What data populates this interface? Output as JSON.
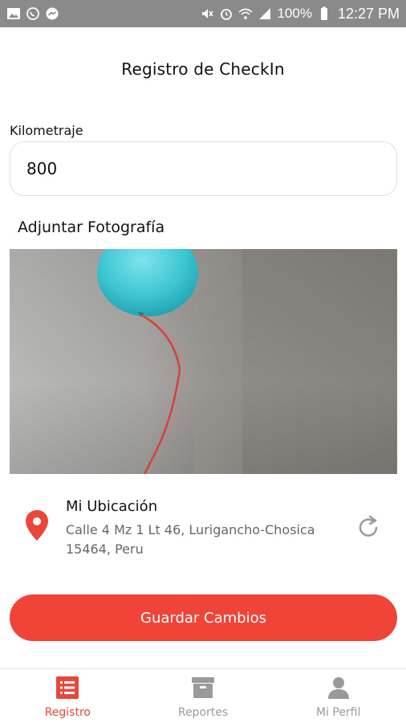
{
  "status_bar": {
    "battery": "100%",
    "time": "12:27 PM"
  },
  "screen": {
    "title": "Registro de CheckIn"
  },
  "form": {
    "kilometraje_label": "Kilometraje",
    "kilometraje_value": "800",
    "photo_label": "Adjuntar Fotografía"
  },
  "location": {
    "title": "Mi Ubicación",
    "address": "Calle 4 Mz 1 Lt 46, Lurigancho-Chosica 15464, Peru"
  },
  "actions": {
    "save_label": "Guardar Cambios"
  },
  "bottom_nav": {
    "items": [
      {
        "label": "Registro",
        "icon": "list-icon",
        "active": true
      },
      {
        "label": "Reportes",
        "icon": "archive-icon",
        "active": false
      },
      {
        "label": "Mi Perfil",
        "icon": "person-icon",
        "active": false
      }
    ]
  },
  "colors": {
    "accent": "#f04438",
    "pin": "#e8473a",
    "status_bar": "#8a8a8a",
    "inactive": "#9a9a9a"
  }
}
